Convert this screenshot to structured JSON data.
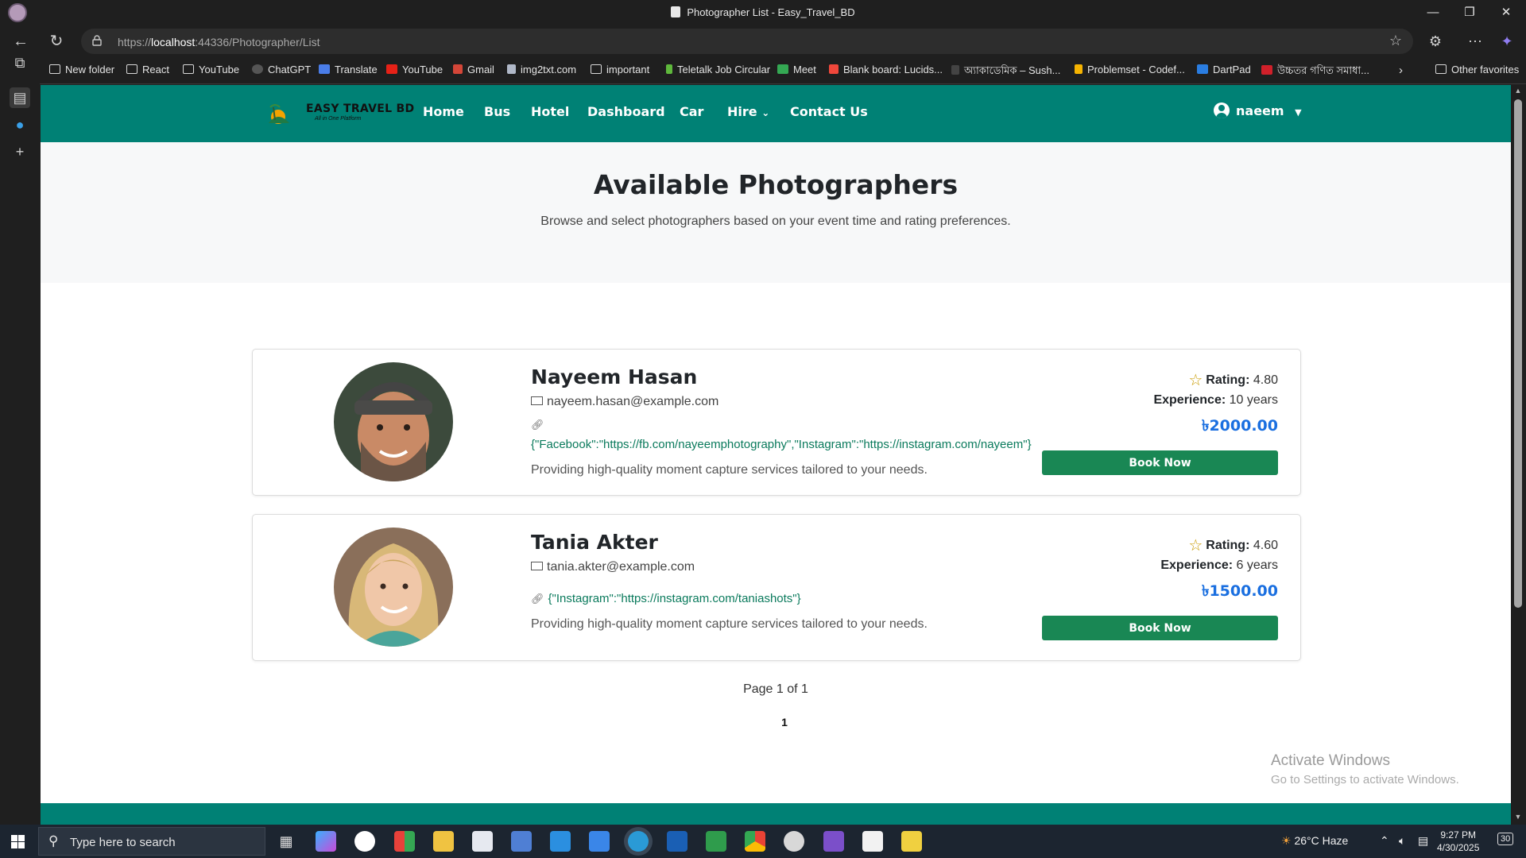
{
  "browser": {
    "window_title": "Photographer List - Easy_Travel_BD",
    "url_prefix": "https://",
    "url_host": "localhost",
    "url_path": ":44336/Photographer/List",
    "bookmarks": [
      "New folder",
      "React",
      "YouTube",
      "ChatGPT",
      "Translate",
      "YouTube",
      "Gmail",
      "img2txt.com",
      "important",
      "Teletalk Job Circular",
      "Meet",
      "Blank board: Lucids...",
      "অ্যাকাডেমিক – Sush...",
      "Problemset - Codef...",
      "DartPad",
      "উচ্চতর গণিত সমাধা..."
    ],
    "other_favorites": "Other favorites"
  },
  "site": {
    "logo_text": "EASY TRAVEL BD",
    "logo_tagline": "All in One Platform",
    "nav": [
      "Home",
      "Bus",
      "Hotel",
      "Dashboard",
      "Car",
      "Hire",
      "Contact Us"
    ],
    "user": "naeem"
  },
  "hero": {
    "title": "Available Photographers",
    "subtitle": "Browse and select photographers based on your event time and rating preferences."
  },
  "labels": {
    "rating": "Rating:",
    "experience": "Experience:",
    "book": "Book Now"
  },
  "photographers": [
    {
      "name": "Nayeem Hasan",
      "email": "nayeem.hasan@example.com",
      "social": "{\"Facebook\":\"https://fb.com/nayeemphotography\",\"Instagram\":\"https://instagram.com/nayeem\"}",
      "description": "Providing high-quality moment capture services tailored to your needs.",
      "rating": "4.80",
      "experience": "10 years",
      "price": "৳2000.00"
    },
    {
      "name": "Tania Akter",
      "email": "tania.akter@example.com",
      "social": "{\"Instagram\":\"https://instagram.com/taniashots\"}",
      "description": "Providing high-quality moment capture services tailored to your needs.",
      "rating": "4.60",
      "experience": "6 years",
      "price": "৳1500.00"
    }
  ],
  "pagination": {
    "text": "Page 1 of 1",
    "current": "1"
  },
  "watermark": {
    "line1": "Activate Windows",
    "line2": "Go to Settings to activate Windows."
  },
  "taskbar": {
    "search_placeholder": "Type here to search",
    "weather": "26°C  Haze",
    "time": "9:27 PM",
    "date": "4/30/2025",
    "notifications": "30"
  },
  "colors": {
    "navbar": "#008175",
    "book_button": "#198754",
    "price": "#1a6fe0"
  }
}
